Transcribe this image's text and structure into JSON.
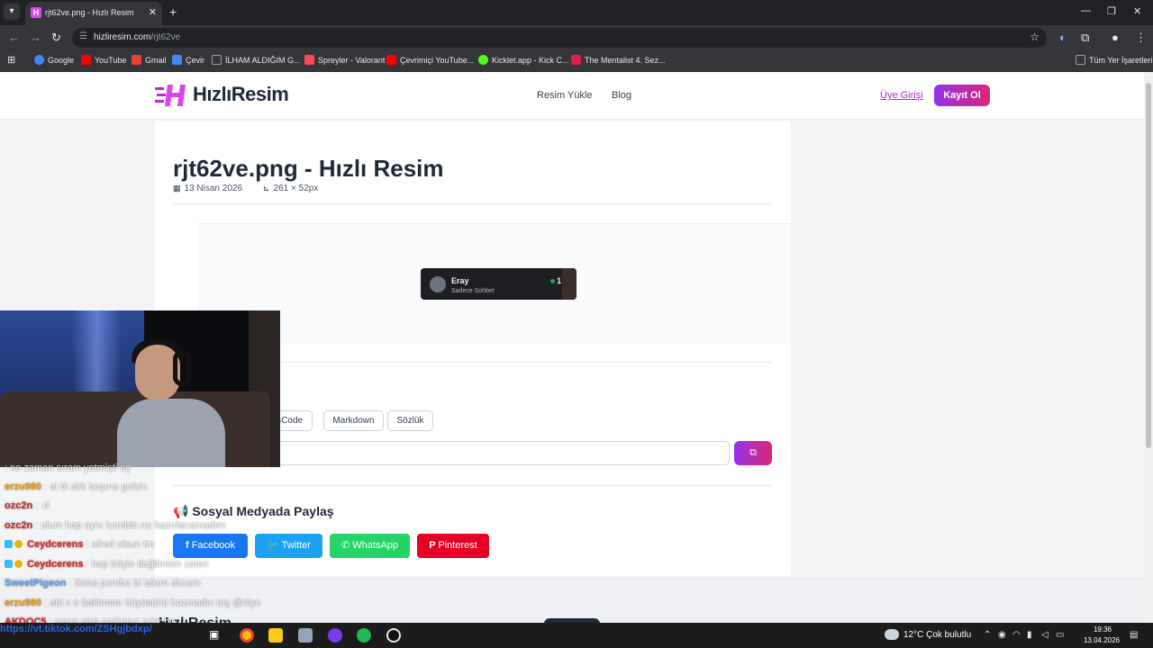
{
  "browser": {
    "tab_title": "rjt62ve.png - Hızlı Resim",
    "tab_favicon": "H",
    "url_domain": "hizliresim.com",
    "url_path": "/rjt62ve",
    "bookmarks": [
      {
        "label": "Google",
        "color": "#4285f4"
      },
      {
        "label": "YouTube",
        "color": "#ff0000"
      },
      {
        "label": "Gmail",
        "color": "#ea4335"
      },
      {
        "label": "Çevir",
        "color": "#4285f4"
      },
      {
        "label": "İLHAM ALDIĞIM G...",
        "color": "#9aa0a6"
      },
      {
        "label": "Spreyler - Valorant",
        "color": "#ff4655"
      },
      {
        "label": "Çevrimiçi YouTube...",
        "color": "#ff0000"
      },
      {
        "label": "Kicklet.app - Kick C...",
        "color": "#53fc18"
      },
      {
        "label": "The Mentalist 4. Sez...",
        "color": "#e11d48"
      }
    ],
    "all_bookmarks": "Tüm Yer İşaretleri"
  },
  "site": {
    "logo": "HızlıResim",
    "nav": [
      "Resim Yükle",
      "Blog"
    ],
    "login": "Üye Girişi",
    "register": "Kayıt Ol",
    "brand_gradient": [
      "#9333ea",
      "#db2777"
    ]
  },
  "image": {
    "title": "rjt62ve.png - Hızlı Resim",
    "date_icon": "calendar-icon",
    "date": "13 Nisan 2026",
    "size_icon": "ruler-icon",
    "size": "261 × 52px"
  },
  "preview_card": {
    "name": "Eray",
    "status": "Sadece Sohbet",
    "count": "1"
  },
  "share": {
    "heading": "aş",
    "formats": [
      "BBCode",
      "Markdown",
      "Sözlük"
    ],
    "link_value": "ve.png",
    "copy_icon": "copy-icon"
  },
  "social": {
    "heading": "Sosyal Medyada Paylaş",
    "buttons": [
      {
        "label": "Facebook",
        "color": "#1877f2"
      },
      {
        "label": "Twitter",
        "color": "#1da1f2"
      },
      {
        "label": "WhatsApp",
        "color": "#25d366"
      },
      {
        "label": "Pinterest",
        "color": "#e60023"
      }
    ]
  },
  "footer": {
    "logo": "HızlıResim"
  },
  "chat": [
    {
      "user": "",
      "msg": ": ne zaman sıram yetmişti aç",
      "color": "#a855f7"
    },
    {
      "user": "erzu980",
      "msg": ": al bi aklı başına gelsin",
      "color": "#f59e0b"
    },
    {
      "user": "ozc2n",
      "msg": ": :d",
      "color": "#dc2626"
    },
    {
      "user": "ozc2n",
      "msg": ": olum hep aynı kombin ne hazırlanamadım",
      "color": "#dc2626"
    },
    {
      "user": "Ceydcerens",
      "msg": ": afred olsun tm",
      "color": "#dc2626"
    },
    {
      "user": "Ceydcerens",
      "msg": ": hep böyle değilmisin zaten",
      "color": "#dc2626"
    },
    {
      "user": "SweetPigeon",
      "msg": ": Sana pembe bi takım alıcam",
      "color": "#60a5fa"
    },
    {
      "user": "erzu980",
      "msg": ": abi x e baktımmı büyüsünü bozmadın inş @nlye",
      "color": "#f59e0b"
    },
    {
      "user": "AKDOC5",
      "msg": ": yayın giriş şarkımız artık bu",
      "color": "#dc2626"
    }
  ],
  "overlay_url": "https://vt.tiktok.com/ZSHgjbdxp/",
  "taskbar": {
    "weather": "12°C  Çok bulutlu",
    "time": "19:36",
    "date": "13.04.2026"
  }
}
